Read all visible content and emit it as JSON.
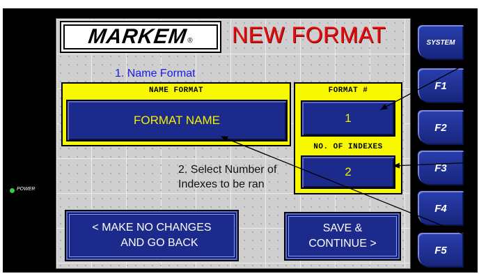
{
  "logo": {
    "text": "MARKEM",
    "reg": "®"
  },
  "screen_title": "NEW FORMAT",
  "annotations": {
    "step1": "1. Name Format",
    "step2": "2. Select Number of Indexes to be ran"
  },
  "name_panel": {
    "header": "NAME FORMAT",
    "value": "FORMAT NAME"
  },
  "format_panel": {
    "format_header": "FORMAT #",
    "format_value": "1",
    "indexes_header": "NO. OF INDEXES",
    "indexes_value": "2"
  },
  "buttons": {
    "back_line1": "< MAKE NO CHANGES",
    "back_line2": "AND GO BACK",
    "save_line1": "SAVE &",
    "save_line2": "CONTINUE >"
  },
  "function_keys": [
    "SYSTEM",
    "F1",
    "F2",
    "F3",
    "F4",
    "F5"
  ],
  "power_label": "POWER",
  "colors": {
    "screen_bg": "#cfcfcf",
    "title_red": "#e30d0d",
    "panel_yellow": "#f8f800",
    "field_blue": "#1c2a8c",
    "field_text_yellow": "#f3f000",
    "annotation_blue": "#1a1ae8",
    "power_led": "#2fd04a"
  },
  "icons": {
    "power": "power-led-icon"
  }
}
